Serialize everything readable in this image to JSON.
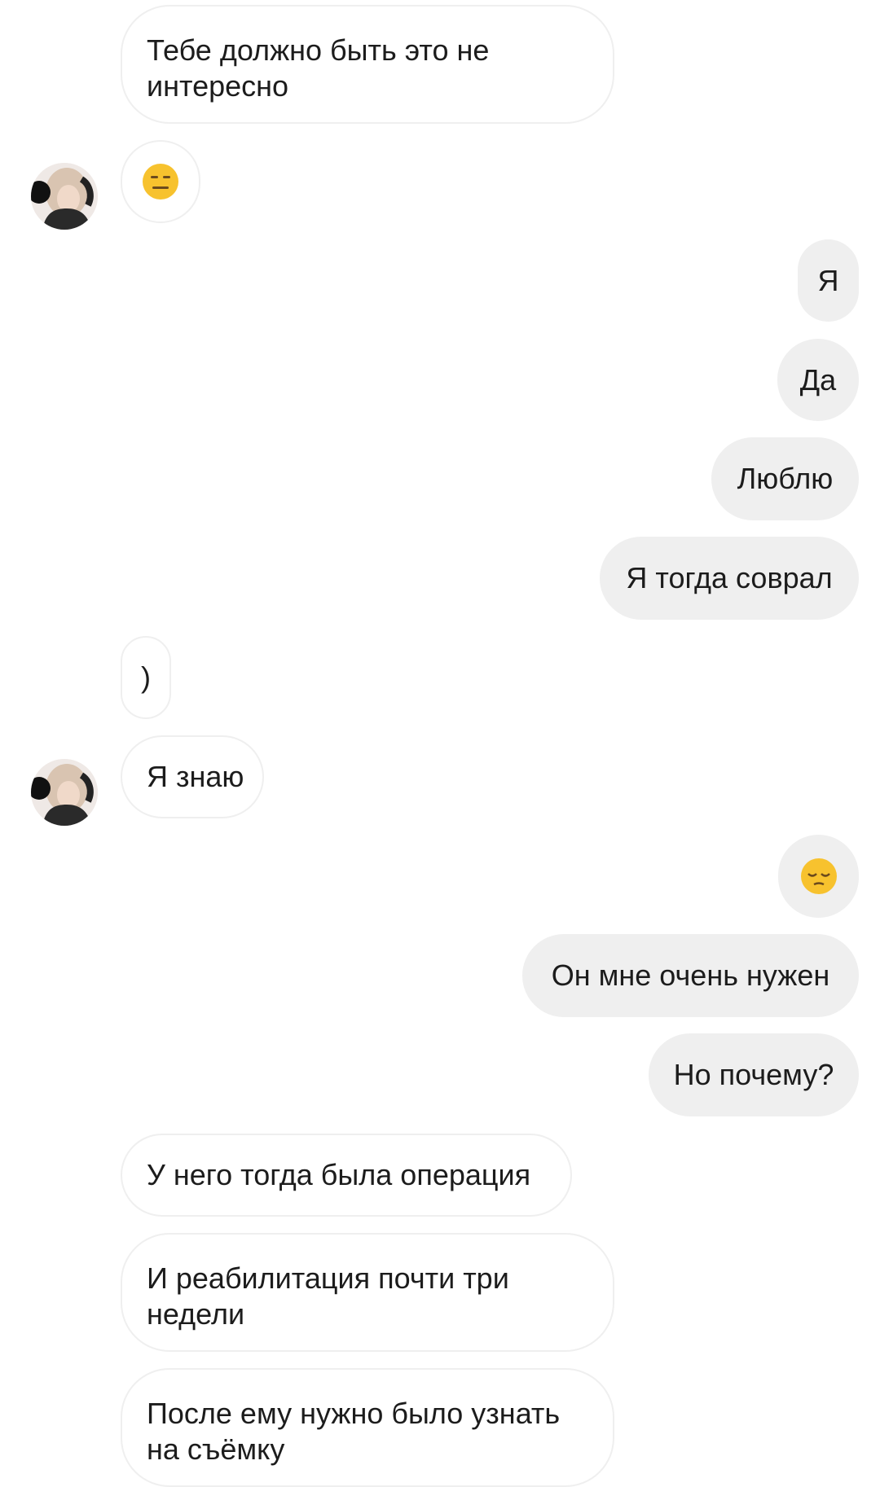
{
  "messages": [
    {
      "id": 1,
      "side": "incoming",
      "text": "Тебе должно быть это не интересно"
    },
    {
      "id": 2,
      "side": "incoming",
      "emoji": "expressionless-face-emoji"
    },
    {
      "id": 3,
      "side": "outgoing",
      "text": "Я"
    },
    {
      "id": 4,
      "side": "outgoing",
      "text": "Да"
    },
    {
      "id": 5,
      "side": "outgoing",
      "text": "Люблю"
    },
    {
      "id": 6,
      "side": "outgoing",
      "text": "Я тогда соврал"
    },
    {
      "id": 7,
      "side": "incoming",
      "text": ")"
    },
    {
      "id": 8,
      "side": "incoming",
      "text": "Я знаю"
    },
    {
      "id": 9,
      "side": "outgoing",
      "emoji": "pensive-face-emoji"
    },
    {
      "id": 10,
      "side": "outgoing",
      "text": "Он мне очень нужен"
    },
    {
      "id": 11,
      "side": "outgoing",
      "text": "Но почему?"
    },
    {
      "id": 12,
      "side": "incoming",
      "text": "У него тогда была операция"
    },
    {
      "id": 13,
      "side": "incoming",
      "text": "И реабилитация почти три недели"
    },
    {
      "id": 14,
      "side": "incoming",
      "text": "После ему нужно было узнать на съёмку"
    }
  ],
  "colors": {
    "incoming_bubble_bg": "#ffffff",
    "incoming_bubble_border": "#efefef",
    "outgoing_bubble_bg": "#efefef",
    "text": "#1c1c1c",
    "emoji_yellow": "#f7c22e"
  },
  "avatar": {
    "icon": "contact-avatar-icon"
  }
}
